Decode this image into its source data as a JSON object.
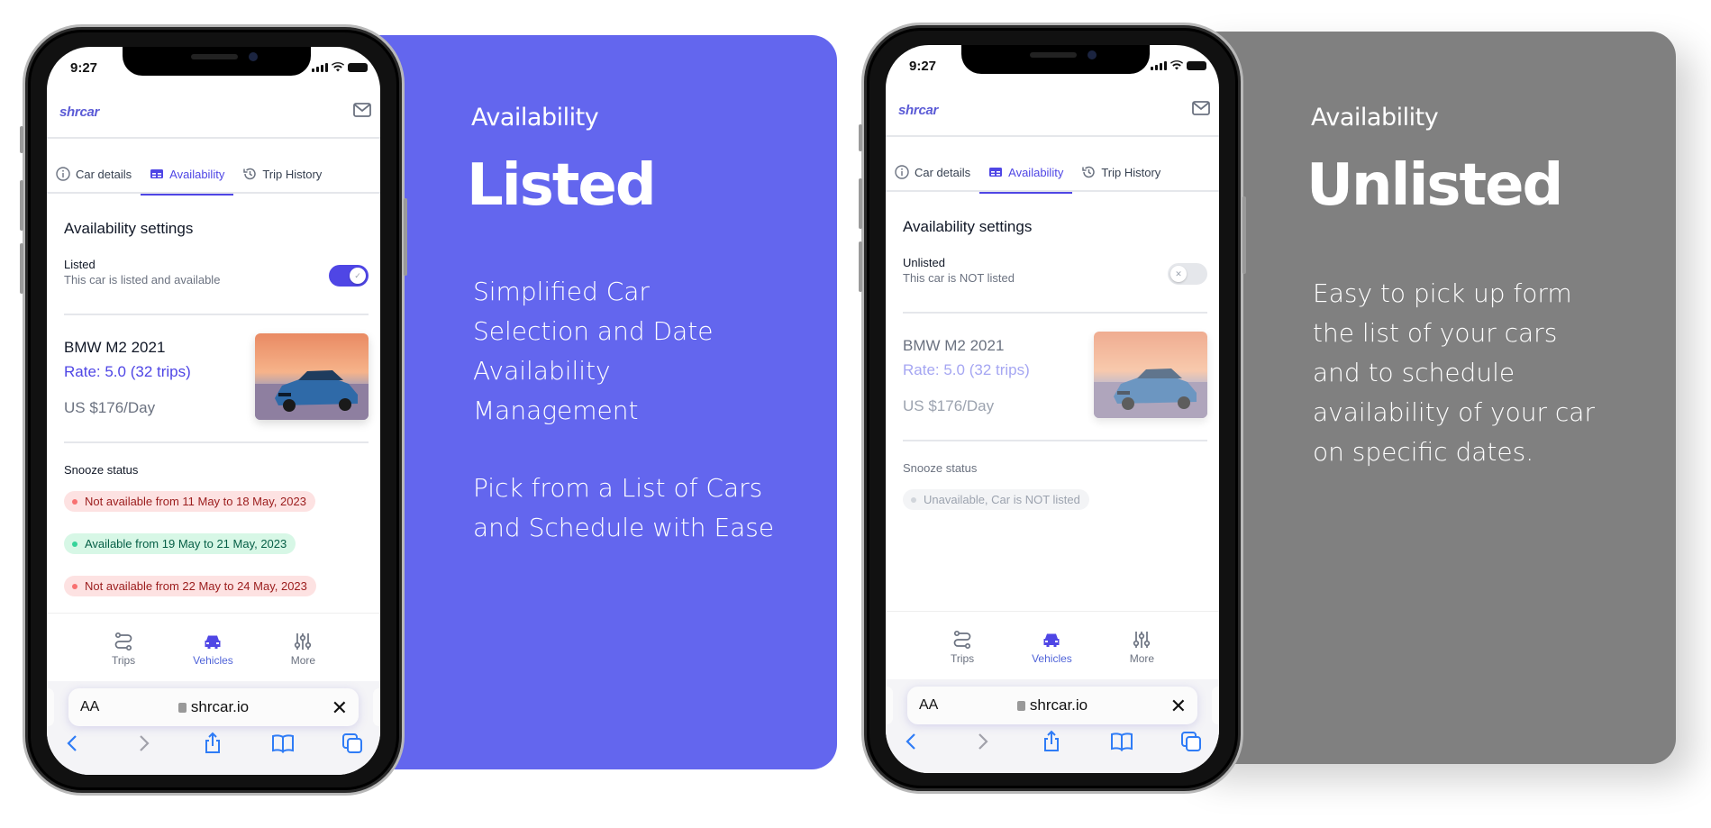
{
  "panels": [
    {
      "card": {
        "eyebrow": "Availability",
        "headline": "Listed",
        "description_1": "Simplified Car Selection and Date Availability Management",
        "description_2": "Pick from a List of Cars and Schedule with Ease",
        "color": "#6366ee"
      },
      "phone": {
        "time": "9:27",
        "logo": "shrcar",
        "tabs": [
          {
            "label": "Car details",
            "icon": "info-icon"
          },
          {
            "label": "Availability",
            "icon": "calendar-grid-icon",
            "active": true
          },
          {
            "label": "Trip History",
            "icon": "history-icon"
          }
        ],
        "section_title": "Availability settings",
        "toggle": {
          "label": "Listed",
          "sub": "This car is listed and available",
          "state": "on",
          "knob_glyph": "✓"
        },
        "car": {
          "name": "BMW M2 2021",
          "rate": "Rate: 5.0 (32 trips)",
          "price": "US $176/Day"
        },
        "snooze_title": "Snooze status",
        "snooze": [
          {
            "text": "Not available from 11 May to 18 May, 2023",
            "status": "red"
          },
          {
            "text": "Available from 19 May to 21 May, 2023",
            "status": "green"
          },
          {
            "text": "Not available from 22 May to 24 May, 2023",
            "status": "red"
          }
        ],
        "nav": [
          {
            "label": "Trips",
            "icon": "route-icon"
          },
          {
            "label": "Vehicles",
            "icon": "car-icon",
            "active": true
          },
          {
            "label": "More",
            "icon": "sliders-icon"
          }
        ],
        "browser": {
          "text_size": "AA",
          "url": "shrcar.io",
          "close": "✕"
        }
      }
    },
    {
      "card": {
        "eyebrow": "Availability",
        "headline": "Unlisted",
        "description_1": "Easy to pick up form the list of your cars and to schedule availability of your car on specific dates.",
        "color": "#808080"
      },
      "phone": {
        "time": "9:27",
        "logo": "shrcar",
        "tabs": [
          {
            "label": "Car details",
            "icon": "info-icon"
          },
          {
            "label": "Availability",
            "icon": "calendar-grid-icon",
            "active": true
          },
          {
            "label": "Trip History",
            "icon": "history-icon"
          }
        ],
        "section_title": "Availability settings",
        "toggle": {
          "label": "Unlisted",
          "sub": "This car is NOT listed",
          "state": "off",
          "knob_glyph": "✕"
        },
        "car": {
          "name": "BMW M2 2021",
          "rate": "Rate: 5.0 (32 trips)",
          "price": "US $176/Day"
        },
        "snooze_title": "Snooze status",
        "snooze": [
          {
            "text": "Unavailable, Car is NOT listed",
            "status": "gray"
          }
        ],
        "nav": [
          {
            "label": "Trips",
            "icon": "route-icon"
          },
          {
            "label": "Vehicles",
            "icon": "car-icon",
            "active": true
          },
          {
            "label": "More",
            "icon": "sliders-icon"
          }
        ],
        "browser": {
          "text_size": "AA",
          "url": "shrcar.io",
          "close": "✕"
        }
      }
    }
  ]
}
